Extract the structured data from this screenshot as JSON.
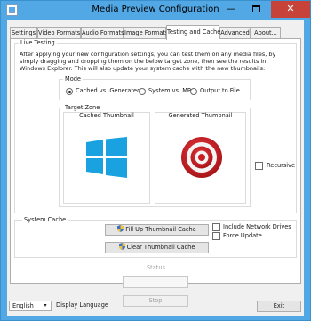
{
  "window": {
    "title": "Media Preview Configuration",
    "close_glyph": "✕",
    "minimize_glyph": "—"
  },
  "tabs": [
    {
      "label": "Settings"
    },
    {
      "label": "Video Formats"
    },
    {
      "label": "Audio Formats"
    },
    {
      "label": "Image Formats"
    },
    {
      "label": "Testing and Cache"
    },
    {
      "label": "Advanced"
    },
    {
      "label": "About..."
    }
  ],
  "active_tab": "Testing and Cache",
  "live_testing": {
    "heading": "Live Testing",
    "description": "After applying your new configuration settings, you can test them on any media files, by simply dragging and dropping them on the below target zone, then see the results in Windows Explorer. This will also update your system cache with the new thumbnails:",
    "mode": {
      "heading": "Mode",
      "options": [
        {
          "label": "Cached vs. Generated",
          "checked": true
        },
        {
          "label": "System vs. MP",
          "checked": false
        },
        {
          "label": "Output to File",
          "checked": false
        }
      ]
    },
    "target_zone": {
      "heading": "Target Zone",
      "cached_label": "Cached Thumbnail",
      "generated_label": "Generated Thumbnail",
      "cached_icon": "windows-logo-icon",
      "generated_icon": "target-icon",
      "recursive_label": "Recursive",
      "recursive_checked": false
    }
  },
  "system_cache": {
    "heading": "System Cache",
    "fill_button": "Fill Up Thumbnail Cache",
    "clear_button": "Clear Thumbnail Cache",
    "include_network_label": "Include Network Drives",
    "include_network_checked": false,
    "force_update_label": "Force Update",
    "force_update_checked": false
  },
  "status": {
    "label": "Status",
    "stop_button": "Stop"
  },
  "footer": {
    "language_value": "English",
    "language_label": "Display Language",
    "exit_button": "Exit"
  },
  "colors": {
    "titlebar": "#52a8e4",
    "close": "#c7433a",
    "windows_logo": "#1aa1e0",
    "target_red": "#d32227"
  }
}
